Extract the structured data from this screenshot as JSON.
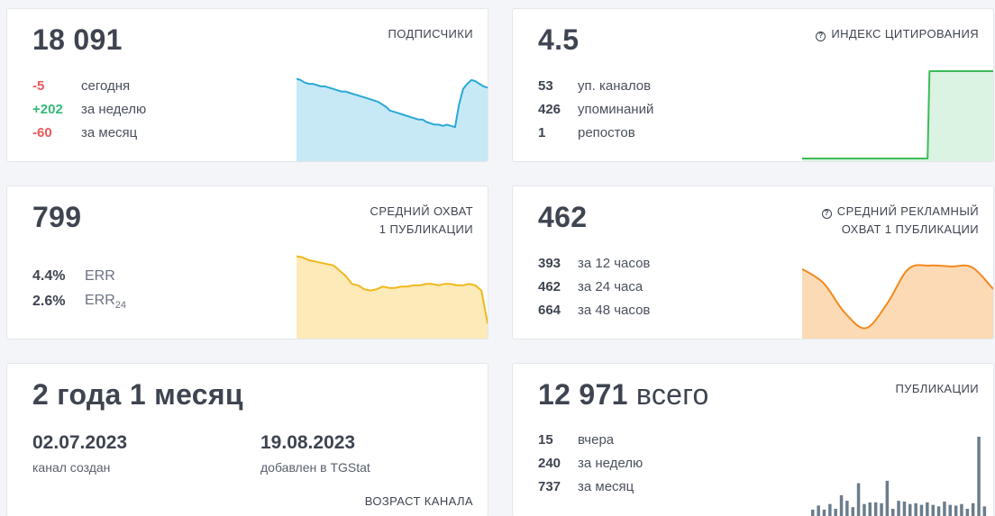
{
  "subscribers": {
    "value": "18 091",
    "label": "ПОДПИСЧИКИ",
    "stats": [
      {
        "value": "-5",
        "text": "сегодня"
      },
      {
        "value": "+202",
        "text": "за неделю"
      },
      {
        "value": "-60",
        "text": "за месяц"
      }
    ],
    "chart_data": {
      "type": "area",
      "color": "#29a9d6",
      "fill": "#bde5f4",
      "values": [
        92,
        91,
        89,
        88,
        88,
        87,
        86,
        86,
        85,
        84,
        83,
        82,
        82,
        81,
        80,
        79,
        78,
        77,
        76,
        75,
        74,
        72,
        70,
        67,
        66,
        65,
        64,
        63,
        62,
        61,
        60,
        60,
        58,
        57,
        56,
        56,
        55,
        56,
        55,
        54,
        72,
        84,
        88,
        91,
        90,
        88,
        86,
        85
      ]
    }
  },
  "citation": {
    "value": "4.5",
    "label": "ИНДЕКС ЦИТИРОВАНИЯ",
    "stats": [
      {
        "value": "53",
        "text": "уп. каналов"
      },
      {
        "value": "426",
        "text": "упоминаний"
      },
      {
        "value": "1",
        "text": "репостов"
      }
    ],
    "chart_data": {
      "type": "area",
      "color": "#3dbb5a",
      "fill": "#d4f1dd",
      "values": [
        0,
        0,
        0,
        0,
        0,
        0,
        0,
        0,
        0,
        0,
        0,
        0,
        0,
        0,
        0,
        0,
        0,
        0,
        0,
        0,
        0,
        0,
        0,
        0,
        0,
        0,
        0,
        0,
        0,
        0,
        0,
        0,
        0,
        0,
        0,
        0,
        0,
        0,
        0,
        0,
        0,
        0,
        0,
        0,
        0,
        0,
        0,
        0,
        0,
        0,
        0,
        0,
        0,
        0,
        0,
        0,
        0,
        0,
        0,
        0,
        0,
        0,
        0,
        0,
        0,
        0,
        100,
        100,
        100,
        100,
        100,
        100,
        100,
        100,
        100,
        100,
        100,
        100,
        100,
        100,
        100,
        100,
        100,
        100,
        100,
        100,
        100,
        100,
        100,
        100,
        100,
        100,
        100,
        100,
        100,
        100,
        100,
        100,
        100,
        100
      ]
    }
  },
  "reach": {
    "value": "799",
    "label_line1": "СРЕДНИЙ ОХВАТ",
    "label_line2": "1 ПУБЛИКАЦИИ",
    "err": [
      {
        "value": "4.4%",
        "text": "ERR",
        "sub": ""
      },
      {
        "value": "2.6%",
        "text": "ERR",
        "sub": "24"
      }
    ],
    "chart_data": {
      "type": "area",
      "color": "#f1b71c",
      "fill": "#fbe6ac",
      "values": [
        91,
        90,
        88,
        87,
        86,
        85,
        84,
        80,
        76,
        70,
        69,
        66,
        65,
        66,
        68,
        67,
        67,
        68,
        68,
        69,
        69,
        70,
        70,
        69,
        70,
        70,
        69,
        69,
        70,
        69,
        65,
        40
      ]
    }
  },
  "ad_reach": {
    "value": "462",
    "label_line1": "СРЕДНИЙ РЕКЛАМНЫЙ",
    "label_line2": "ОХВАТ 1 ПУБЛИКАЦИИ",
    "stats": [
      {
        "value": "393",
        "text": "за 12 часов"
      },
      {
        "value": "462",
        "text": "за 24 часа"
      },
      {
        "value": "664",
        "text": "за 48 часов"
      }
    ],
    "chart_data": {
      "type": "area",
      "color": "#f28a1f",
      "fill": "#fcd3a8",
      "values": [
        78,
        62,
        28,
        10,
        38,
        78,
        82,
        81,
        80,
        55
      ]
    }
  },
  "age": {
    "value": "2 года 1 месяц",
    "created_date": "02.07.2023",
    "created_label": "канал создан",
    "added_date": "19.08.2023",
    "added_label": "добавлен в TGStat",
    "label": "ВОЗРАСТ КАНАЛА"
  },
  "posts": {
    "value": "12 971",
    "suffix": "всего",
    "label": "ПУБЛИКАЦИИ",
    "stats": [
      {
        "value": "15",
        "text": "вчера"
      },
      {
        "value": "240",
        "text": "за неделю"
      },
      {
        "value": "737",
        "text": "за месяц"
      }
    ],
    "chart_data": {
      "type": "bar",
      "color": "#6b7d8c",
      "values": [
        8,
        13,
        8,
        15,
        9,
        26,
        19,
        11,
        41,
        15,
        17,
        17,
        16,
        44,
        9,
        19,
        18,
        15,
        16,
        14,
        17,
        14,
        12,
        18,
        14,
        13,
        15,
        9,
        16,
        99,
        12
      ]
    }
  }
}
